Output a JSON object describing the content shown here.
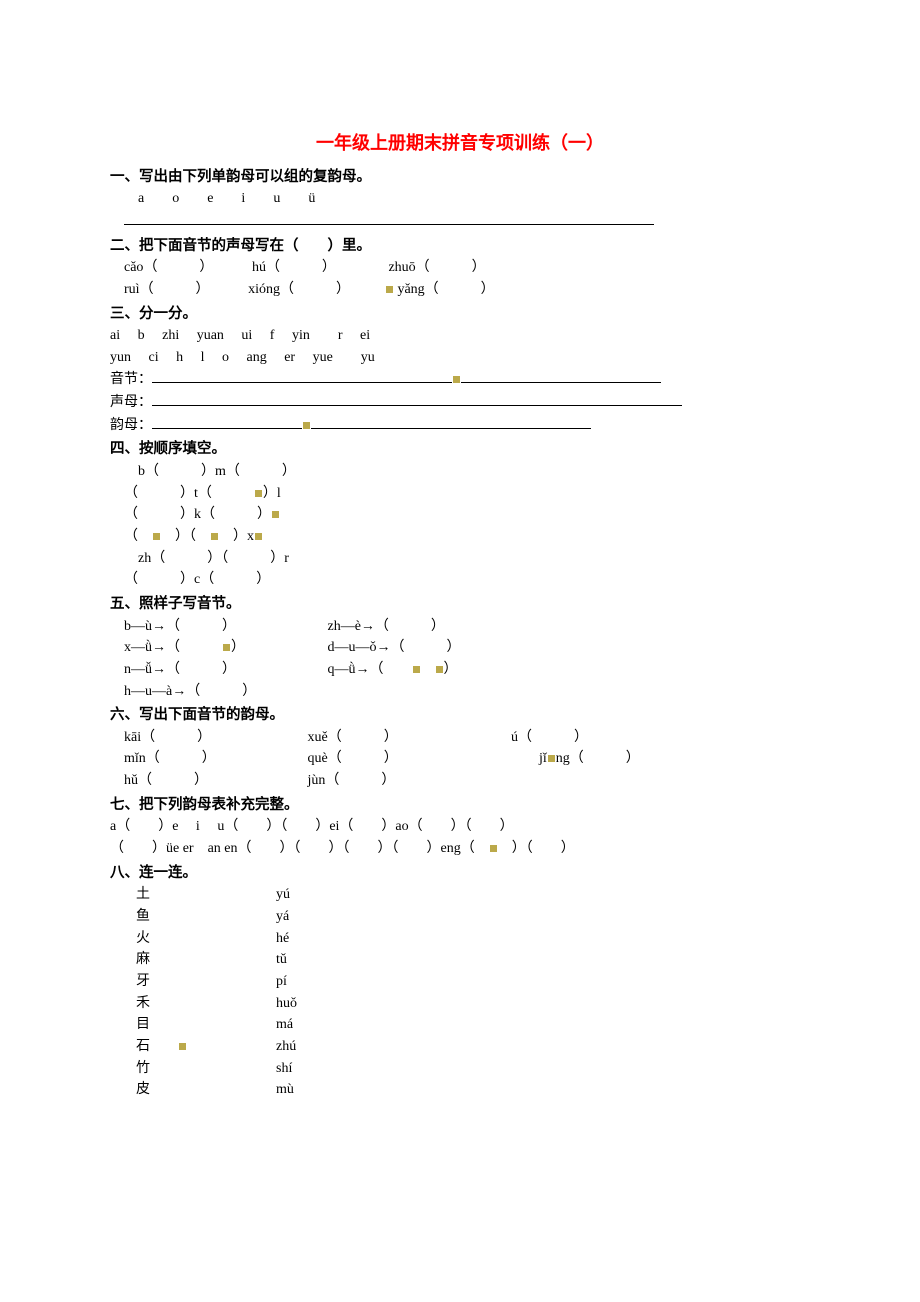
{
  "title": "一年级上册期末拼音专项训练（一）",
  "sections": {
    "s1": {
      "heading": "一、写出由下列单韵母可以组的复韵母。",
      "vowels_line": "　a　　o　　e　　i　　u　　ü"
    },
    "s2": {
      "heading": "二、把下面音节的声母写在（　　）里。",
      "items": [
        {
          "syllable": "cǎo",
          "blank": "（　　　）"
        },
        {
          "syllable": "hú",
          "blank": "（　　　）"
        },
        {
          "syllable": "zhuō",
          "blank": "（　　　）"
        },
        {
          "syllable": "ruì",
          "blank": "（　　　）"
        },
        {
          "syllable": "xióng",
          "blank": "（　　　）"
        },
        {
          "syllable": "yǎng",
          "blank": "（　　　）"
        }
      ]
    },
    "s3": {
      "heading": "三、分一分。",
      "line1": "ai　 b　 zhi　 yuan　 ui　 f　 yin　　r　 ei",
      "line2": "yun　 ci　 h　 l　 o　 ang　 er　 yue　　yu",
      "label_yinjie": "音节：",
      "label_shengmu": "声母：",
      "label_yunmu": "韵母："
    },
    "s4": {
      "heading": "四、按顺序填空。",
      "lines": [
        {
          "t": "　b（　　　）m（　　　）"
        },
        {
          "t": "（　　　）t（　　　）l",
          "dot_between": "）l",
          "has_dot": true
        },
        {
          "t": "（　　　）k（　　　）",
          "trail_dot": true
        },
        {
          "t": "（　　）（　　　）x",
          "dots_in": true
        },
        {
          "t": "　zh（　　　）（　　　）r"
        },
        {
          "t": "（　　　）c（　　　）"
        }
      ],
      "raw_lines": [
        "　b（　　　）m（　　　）",
        "（　　　）t（　　　,）l",
        "（　　　）k（　　　）.",
        "（　.　）（　.　）x.",
        "　zh（　　　）（　　　）r",
        "（　　　）c（　　　）"
      ]
    },
    "s5": {
      "heading": "五、照样子写音节。",
      "rows": [
        {
          "a": "b—ù→（　　　）",
          "b": "zh—è→（　　　）"
        },
        {
          "a": "x—ǜ→（　　　,）",
          "b": "d—u—ǒ→（　　　）"
        },
        {
          "a": "n—ǚ→（　　　）",
          "b": "q—ǜ→（　　.　,）"
        },
        {
          "a": "h—u—à→（　　　）",
          "b": ""
        }
      ]
    },
    "s6": {
      "heading": "六、写出下面音节的韵母。",
      "rows": [
        [
          {
            "syllable": "kāi",
            "blank": "（　　　）"
          },
          {
            "syllable": "xuě",
            "blank": "（　　　）"
          },
          {
            "syllable": "ú",
            "blank": "（　　　）"
          }
        ],
        [
          {
            "syllable": "mǐn",
            "blank": "（　　　）"
          },
          {
            "syllable": "què",
            "blank": "（　　　）"
          },
          {
            "syllable": "jǐ.ng",
            "blank": "（　　　）"
          }
        ],
        [
          {
            "syllable": "hǔ",
            "blank": "（　　　）"
          },
          {
            "syllable": "jùn",
            "blank": "（　　　）"
          },
          {
            "syllable": "",
            "blank": ""
          }
        ]
      ]
    },
    "s7": {
      "heading": "七、把下列韵母表补充完整。",
      "line1": "a（　　）e　 i　 u（　　）（　　）ei（　　）ao（　　）（　　）",
      "line2": "（　　）üe er　an en（　　）（　　）（　　）（　　）eng（　.　）（　　）"
    },
    "s8": {
      "heading": "八、连一连。",
      "pairs": [
        {
          "hanzi": "土",
          "pinyin": "yú"
        },
        {
          "hanzi": "鱼",
          "pinyin": "yá"
        },
        {
          "hanzi": "火",
          "pinyin": "hé"
        },
        {
          "hanzi": "麻",
          "pinyin": "tǔ"
        },
        {
          "hanzi": "牙",
          "pinyin": "pí"
        },
        {
          "hanzi": "禾",
          "pinyin": "huǒ"
        },
        {
          "hanzi": "目",
          "pinyin": "má"
        },
        {
          "hanzi": "石",
          "pinyin": "zhú",
          "dot": true
        },
        {
          "hanzi": "竹",
          "pinyin": "shí"
        },
        {
          "hanzi": "皮",
          "pinyin": "mù"
        }
      ]
    }
  }
}
